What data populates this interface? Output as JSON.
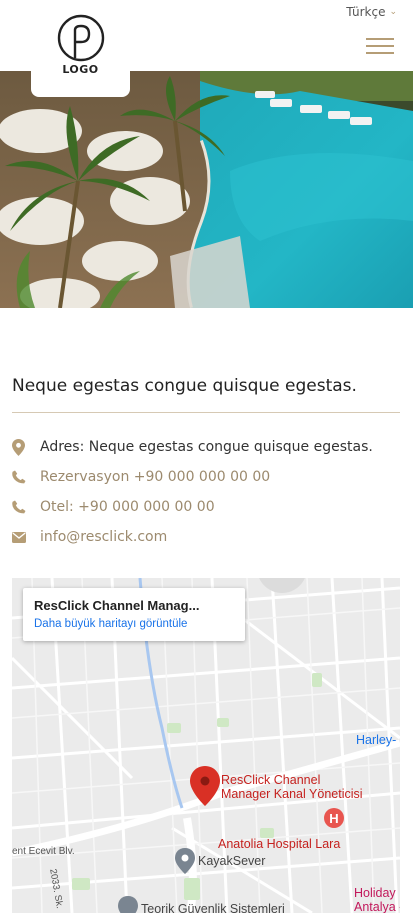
{
  "header": {
    "language": "Türkçe",
    "logo_text": "LOGO"
  },
  "hero": {
    "image": "resort-pool-with-palms-and-umbrellas"
  },
  "content": {
    "title": "Neque egestas congue quisque egestas.",
    "address": "Adres: Neque egestas congue quisque egestas.",
    "reservation": "Rezervasyon +90 000 000 00 00",
    "phone": "Otel: +90 000 000 00 00",
    "email": "info@resclick.com",
    "icons": [
      "map-marker-icon",
      "phone-icon",
      "phone-icon",
      "envelope-icon"
    ]
  },
  "map": {
    "place_name": "ResClick Channel Manag...",
    "view_larger": "Daha büyük haritayı görüntüle",
    "pin_label_line1": "ResClick Channel",
    "pin_label_line2": "Manager Kanal Yöneticisi",
    "hospital": "Anatolia Hospital Lara",
    "kayak": "KayakSever",
    "street": "ent Ecevit Blv.",
    "street_2033": "2033. Sk.",
    "harley": "Harley-",
    "holiday_1": "Holiday",
    "holiday_2": "Antalya - L",
    "security": "Teorik Güvenlik Sistemleri"
  },
  "colors": {
    "accent": "#b59d76",
    "map_pin": "#d93025",
    "hospital": "#c5221f",
    "link": "#1a73e8"
  }
}
